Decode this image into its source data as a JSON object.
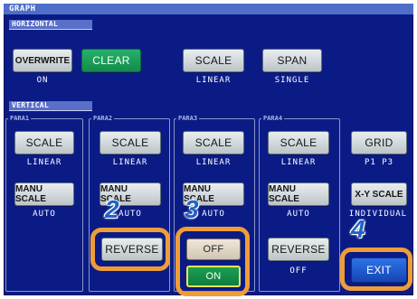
{
  "title": "GRAPH",
  "horizontal": {
    "label": "HORIZONTAL",
    "overwrite": {
      "label": "OVERWRITE",
      "value": "ON"
    },
    "clear": {
      "label": "CLEAR"
    },
    "scale": {
      "label": "SCALE",
      "value": "LINEAR"
    },
    "span": {
      "label": "SPAN",
      "value": "SINGLE"
    }
  },
  "vertical": {
    "label": "VERTICAL",
    "params": [
      {
        "label": "PARA1",
        "scale_label": "SCALE",
        "scale_value": "LINEAR",
        "manu_label": "MANU SCALE",
        "manu_value": "AUTO"
      },
      {
        "label": "PARA2",
        "scale_label": "SCALE",
        "scale_value": "LINEAR",
        "manu_label": "MANU SCALE",
        "manu_value": "AUTO"
      },
      {
        "label": "PARA3",
        "scale_label": "SCALE",
        "scale_value": "LINEAR",
        "manu_label": "MANU SCALE",
        "manu_value": "AUTO"
      },
      {
        "label": "PARA4",
        "scale_label": "SCALE",
        "scale_value": "LINEAR",
        "manu_label": "MANU SCALE",
        "manu_value": "AUTO"
      }
    ],
    "reverse2": {
      "label": "REVERSE"
    },
    "off_option": {
      "label": "OFF"
    },
    "on_option": {
      "label": "ON"
    },
    "reverse4": {
      "label": "REVERSE",
      "value": "OFF"
    },
    "grid": {
      "label": "GRID",
      "value": "P1 P3"
    },
    "xy_scale": {
      "label": "X-Y SCALE",
      "value": "INDIVIDUAL"
    },
    "exit": {
      "label": "EXIT"
    }
  },
  "annotations": {
    "step2": "2",
    "step3": "3",
    "step4": "4"
  },
  "colors": {
    "panel": "#0b1b86",
    "title_bar": "#4f6ec9",
    "highlight_ring": "#ee9d38",
    "step_number": "#1f64c8",
    "selected_green": "#138b4b",
    "exit_blue": "#1545b4"
  }
}
